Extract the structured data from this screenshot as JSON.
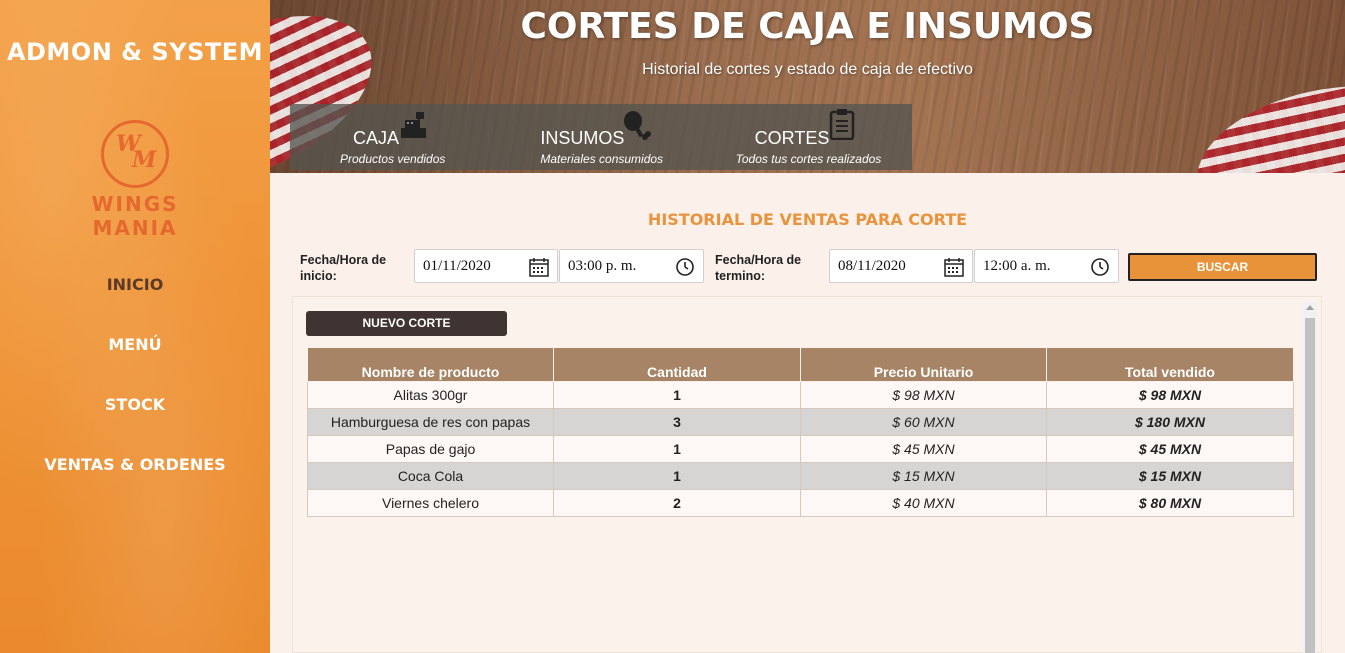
{
  "sidebar": {
    "brand": "ADMON & SYSTEM",
    "logo": {
      "monogram_w": "W",
      "monogram_m": "M",
      "wordmark": "WINGS MANIA",
      "icon": "wings-mania-logo"
    },
    "items": [
      {
        "label": "INICIO",
        "active": true
      },
      {
        "label": "MENÚ"
      },
      {
        "label": "STOCK"
      },
      {
        "label": "VENTAS & ORDENES"
      }
    ]
  },
  "header": {
    "title": "CORTES DE CAJA E INSUMOS",
    "subtitle": "Historial de cortes y estado de caja de efectivo",
    "tabs": [
      {
        "label": "CAJA",
        "desc": "Productos vendidos",
        "icon": "cash-register-icon"
      },
      {
        "label": "INSUMOS",
        "desc": "Materiales consumidos",
        "icon": "chicken-leg-icon"
      },
      {
        "label": "CORTES",
        "desc": "Todos tus cortes realizados",
        "icon": "clipboard-icon"
      }
    ]
  },
  "main": {
    "section_title": "HISTORIAL DE VENTAS PARA CORTE",
    "filters": {
      "start_label": "Fecha/Hora de inicio:",
      "start_date": "01/11/2020",
      "start_time": "03:00 p. m.",
      "end_label": "Fecha/Hora de termino:",
      "end_date": "08/11/2020",
      "end_time": "12:00 a. m.",
      "search_label": "BUSCAR"
    },
    "new_cut_label": "NUEVO CORTE",
    "table": {
      "headers": [
        "Nombre de producto",
        "Cantidad",
        "Precio Unitario",
        "Total vendido"
      ],
      "rows": [
        [
          "Alitas 300gr",
          "1",
          "$ 98 MXN",
          "$ 98 MXN"
        ],
        [
          "Hamburguesa de res con papas",
          "3",
          "$ 60 MXN",
          "$ 180 MXN"
        ],
        [
          "Papas de gajo",
          "1",
          "$ 45 MXN",
          "$ 45 MXN"
        ],
        [
          "Coca Cola",
          "1",
          "$ 15 MXN",
          "$ 15 MXN"
        ],
        [
          "Viernes chelero",
          "2",
          "$ 40 MXN",
          "$ 80 MXN"
        ]
      ]
    }
  },
  "colors": {
    "accent": "#e8923a",
    "sidebar": "#ef9336",
    "table_header": "#a78465",
    "logo": "#e5682f"
  }
}
